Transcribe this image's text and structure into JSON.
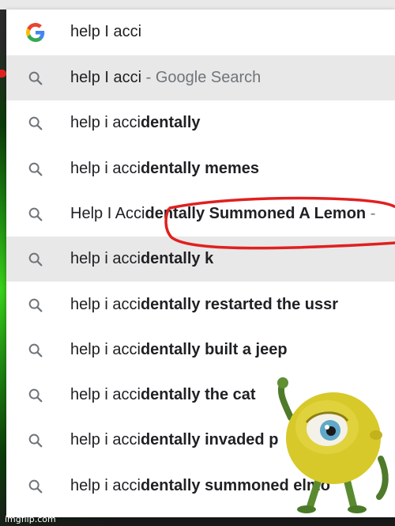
{
  "search": {
    "query": "help I acci",
    "logo_icon": "google-g-icon"
  },
  "suggestions": [
    {
      "plain": "help I acci",
      "bold": "",
      "suffix": " - Google Search",
      "highlight": true
    },
    {
      "plain": "help i acci",
      "bold": "dentally",
      "suffix": "",
      "highlight": false
    },
    {
      "plain": "help i acci",
      "bold": "dentally memes",
      "suffix": "",
      "highlight": false
    },
    {
      "plain": "Help I Acci",
      "bold": "dentally Summoned A Lemon",
      "suffix": " -",
      "highlight": false
    },
    {
      "plain": "help i acci",
      "bold": "dentally k",
      "suffix": "",
      "highlight": true
    },
    {
      "plain": "help i acci",
      "bold": "dentally restarted the ussr",
      "suffix": "",
      "highlight": false
    },
    {
      "plain": "help i acci",
      "bold": "dentally built a jeep",
      "suffix": "",
      "highlight": false
    },
    {
      "plain": "help i acci",
      "bold": "dentally the cat",
      "suffix": "",
      "highlight": false
    },
    {
      "plain": "help i acci",
      "bold": "dentally invaded p",
      "suffix": "",
      "highlight": false
    },
    {
      "plain": "help i acci",
      "bold": "dentally summoned elmo",
      "suffix": "",
      "highlight": false
    }
  ],
  "icons": {
    "suggestion": "search-icon"
  },
  "colors": {
    "accent": "#1a73e8",
    "highlight_row": "#e8e8e8",
    "annotation": "#e02020"
  },
  "watermark": "imgflip.com"
}
